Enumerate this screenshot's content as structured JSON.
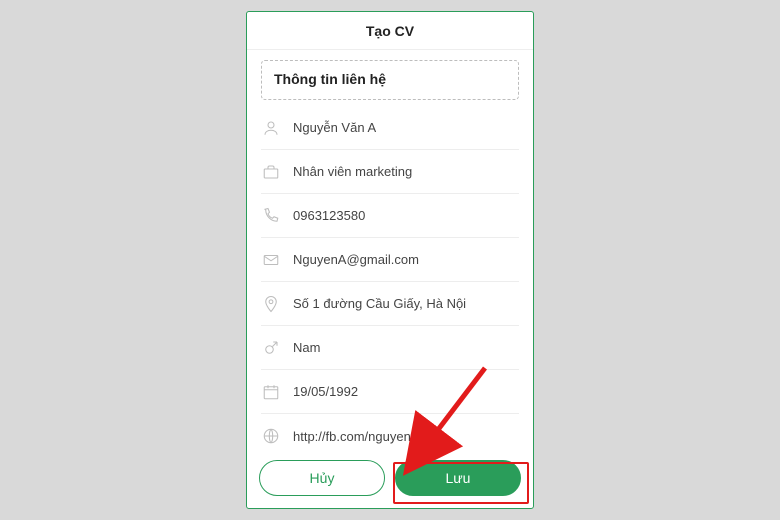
{
  "header": {
    "title": "Tạo CV"
  },
  "section": {
    "title": "Thông tin liên hệ"
  },
  "fields": {
    "name": {
      "value": "Nguyễn Văn A"
    },
    "job": {
      "value": "Nhân viên marketing"
    },
    "phone": {
      "value": "0963123580"
    },
    "email": {
      "value": "NguyenA@gmail.com"
    },
    "address": {
      "value": "Số 1 đường Cầu Giấy, Hà Nội"
    },
    "gender": {
      "value": "Nam"
    },
    "dob": {
      "value": "19/05/1992"
    },
    "website": {
      "value": "http://fb.com/nguyenvana"
    }
  },
  "buttons": {
    "cancel": "Hủy",
    "save": "Lưu"
  }
}
